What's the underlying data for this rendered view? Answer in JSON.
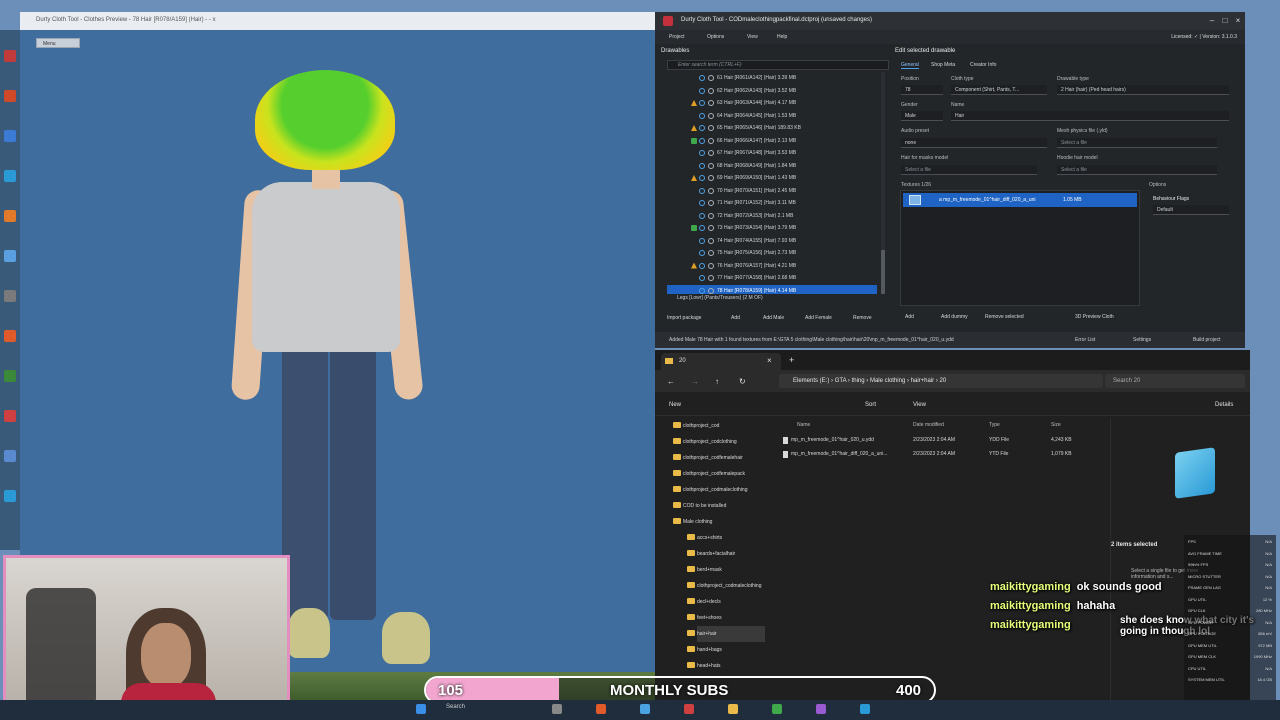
{
  "preview": {
    "title": "Durty Cloth Tool - Clothes Preview - 78 Hair [R078/A159] (Hair) - - x",
    "menu_label": "Menu"
  },
  "tool": {
    "title": "Durty Cloth Tool - CODmaleclothingpackfinal.dctproj (unsaved changes)",
    "licensed": "Licensed: ✓ | Version: 3.1.0.3",
    "menu": [
      "Project",
      "Options",
      "View",
      "Help"
    ],
    "drawables_header": "Drawables",
    "search_placeholder": "Enter search term (CTRL+F)",
    "tree_items": [
      {
        "label": "61 Hair [R061/A142] (Hair) 3.39 MB",
        "status": "none"
      },
      {
        "label": "62 Hair [R062/A143] (Hair) 3.52 MB",
        "status": "none"
      },
      {
        "label": "63 Hair [R063/A144] (Hair) 4.17 MB",
        "status": "warn"
      },
      {
        "label": "64 Hair [R064/A145] (Hair) 1.53 MB",
        "status": "none"
      },
      {
        "label": "65 Hair [R065/A146] (Hair) 189.83 KB",
        "status": "warn"
      },
      {
        "label": "66 Hair [R066/A147] (Hair) 2.13 MB",
        "status": "ok"
      },
      {
        "label": "67 Hair [R067/A148] (Hair) 3.53 MB",
        "status": "none"
      },
      {
        "label": "68 Hair [R068/A149] (Hair) 1.84 MB",
        "status": "none"
      },
      {
        "label": "69 Hair [R069/A150] (Hair) 1.43 MB",
        "status": "warn"
      },
      {
        "label": "70 Hair [R070/A151] (Hair) 2.45 MB",
        "status": "none"
      },
      {
        "label": "71 Hair [R071/A152] (Hair) 3.11 MB",
        "status": "none"
      },
      {
        "label": "72 Hair [R072/A153] (Hair) 2.1 MB",
        "status": "none"
      },
      {
        "label": "73 Hair [R073/A154] (Hair) 3.79 MB",
        "status": "ok"
      },
      {
        "label": "74 Hair [R074/A155] (Hair) 7.93 MB",
        "status": "none"
      },
      {
        "label": "75 Hair [R075/A156] (Hair) 2.73 MB",
        "status": "none"
      },
      {
        "label": "76 Hair [R076/A157] (Hair) 4.21 MB",
        "status": "warn"
      },
      {
        "label": "77 Hair [R077/A158] (Hair) 2.68 MB",
        "status": "none"
      },
      {
        "label": "78 Hair [R078/A159] (Hair) 4.14 MB",
        "status": "none",
        "selected": true
      }
    ],
    "legs_row": "Legs [Lowr] (Pants/Trousers) (2 M OF)",
    "bottom_buttons": [
      "Import package",
      "Add",
      "Add Male",
      "Add Female",
      "Remove"
    ],
    "edit_header": "Edit selected drawable",
    "edit_tabs": [
      "General",
      "Shop Meta",
      "Creator Info"
    ],
    "position_label": "Position",
    "position_value": "78",
    "cloth_type_label": "Cloth type",
    "cloth_type_value": "Component (Shirt, Pants, T...",
    "drawable_type_label": "Drawable type",
    "drawable_type_value": "2   Hair (hair) (Ped head hairs)",
    "gender_label": "Gender",
    "gender_value": "Male",
    "name_label": "Name",
    "name_value": "Hair",
    "audio_label": "Audio preset",
    "audio_value": "none",
    "mesh_physics_label": "Mesh physics file (.yld)",
    "mesh_physics_placeholder": "Select a file",
    "hair_masks_label": "Hair for masks model",
    "hair_masks_placeholder": "Select a file",
    "hoodie_label": "Hoodie hair model",
    "hoodie_placeholder": "Select a file",
    "textures_label": "Textures 1/26",
    "texture_file": "a  mp_m_freemode_01^hair_diff_020_a_uni",
    "texture_size": "1.05 MB",
    "options_label": "Options",
    "behaviour_label": "Behaviour Flags",
    "behaviour_value": "Default",
    "texture_buttons": [
      "Add",
      "Add dummy",
      "Remove selected",
      "3D Preview Cloth"
    ],
    "status_text": "Added Male 78 Hair with 1 found textures from E:\\GTA 5 clothing\\Male clothing\\hair\\hair\\20\\mp_m_freemode_01^hair_020_u.ydd",
    "status_buttons": [
      "Error List",
      "Settings",
      "Build project"
    ]
  },
  "explorer": {
    "tab_title": "20",
    "breadcrumb": [
      "Elements (E:)",
      "GTA",
      "thing",
      "Male clothing",
      "hair+hair",
      "20"
    ],
    "search_placeholder": "Search 20",
    "toolbar": [
      "New",
      "Sort",
      "View",
      "Details"
    ],
    "nav_items": [
      {
        "label": "clothproject_cod",
        "indent": 1
      },
      {
        "label": "clothproject_codclothing",
        "indent": 1
      },
      {
        "label": "clothproject_codfemalehair",
        "indent": 1
      },
      {
        "label": "clothproject_codfemalepack",
        "indent": 1
      },
      {
        "label": "clothproject_codmaleclothing",
        "indent": 1
      },
      {
        "label": "COD to be installed",
        "indent": 1
      },
      {
        "label": "Male clothing",
        "indent": 1
      },
      {
        "label": "accs+shirts",
        "indent": 2
      },
      {
        "label": "beards+facialhair",
        "indent": 2
      },
      {
        "label": "berd+mask",
        "indent": 2
      },
      {
        "label": "clothproject_codmaleclothing",
        "indent": 2
      },
      {
        "label": "decl+decls",
        "indent": 2
      },
      {
        "label": "feet+shoes",
        "indent": 2
      },
      {
        "label": "hair+hair",
        "indent": 2,
        "selected": true
      },
      {
        "label": "hand+bags",
        "indent": 2
      },
      {
        "label": "head+hats",
        "indent": 2
      }
    ],
    "columns": [
      "Name",
      "Date modified",
      "Type",
      "Size"
    ],
    "files": [
      {
        "name": "mp_m_freemode_01^hair_020_u.ydd",
        "date": "2/23/2023 2:04 AM",
        "type": "YDD File",
        "size": "4,243 KB"
      },
      {
        "name": "mp_m_freemode_01^hair_diff_020_a_uni...",
        "date": "2/23/2023 2:04 AM",
        "type": "YTD File",
        "size": "1,079 KB"
      }
    ],
    "items_selected": "2 items selected",
    "select_hint": "Select a single file to get more information and s..."
  },
  "chat": [
    {
      "user": "maikittygaming",
      "message": "ok sounds good"
    },
    {
      "user": "maikittygaming",
      "message": "hahaha"
    },
    {
      "user": "maikittygaming",
      "message": "she does know what city it's going in though lol"
    }
  ],
  "perf": [
    {
      "label": "FPS",
      "value": "N/A"
    },
    {
      "label": "AVG FRAME TIME",
      "value": "N/A"
    },
    {
      "label": "99th% FPS",
      "value": "N/A"
    },
    {
      "label": "MICRO STUTTER",
      "value": "N/A"
    },
    {
      "label": "FRAME GEN LAG",
      "value": "N/A"
    },
    {
      "label": "GPU UTIL",
      "value": "12 %"
    },
    {
      "label": "GPU CLK",
      "value": "280 MHz"
    },
    {
      "label": "GPU POWER",
      "value": "N/A"
    },
    {
      "label": "GPU VOLTAGE",
      "value": "856 mV"
    },
    {
      "label": "GPU MEM UTIL",
      "value": "972 MB"
    },
    {
      "label": "GPU MEM CLK",
      "value": "1990 MHz"
    },
    {
      "label": "CPU UTIL",
      "value": "N/A"
    },
    {
      "label": "SYSTEM MEM UTIL",
      "value": "18.4 GB"
    }
  ],
  "subs": {
    "current": "105",
    "label": "MONTHLY SUBS",
    "goal": "400",
    "progress": 0.2625
  },
  "taskbar": {
    "search_label": "Search"
  },
  "colors": {
    "accent": "#1f64c4",
    "warn": "#e0a024",
    "ok": "#3fa84a",
    "subs_fill": "#f2a6cf"
  }
}
